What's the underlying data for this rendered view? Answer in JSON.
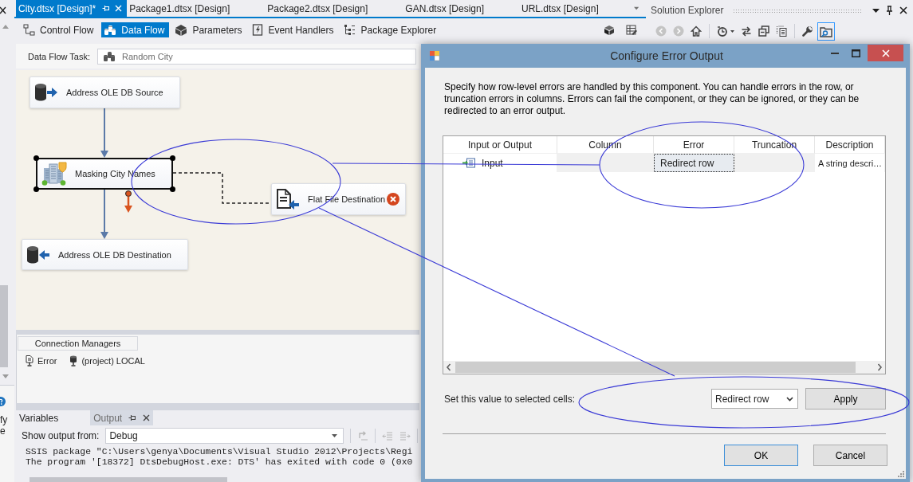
{
  "left_strip": {
    "fragments": [
      "fy",
      "e"
    ]
  },
  "document_tabs": [
    {
      "label": "City.dtsx [Design]*",
      "selected": true
    },
    {
      "label": "Package1.dtsx [Design]",
      "selected": false
    },
    {
      "label": "Package2.dtsx [Design]",
      "selected": false
    },
    {
      "label": "GAN.dtsx [Design]",
      "selected": false
    },
    {
      "label": "URL.dtsx [Design]",
      "selected": false
    }
  ],
  "designer_tabs": [
    {
      "kind": "control_flow",
      "label": "Control Flow",
      "selected": false
    },
    {
      "kind": "data_flow",
      "label": "Data Flow",
      "selected": true
    },
    {
      "kind": "parameters",
      "label": "Parameters",
      "selected": false
    },
    {
      "kind": "event_handlers",
      "label": "Event Handlers",
      "selected": false
    },
    {
      "kind": "package_explorer",
      "label": "Package Explorer",
      "selected": false
    }
  ],
  "data_flow_task": {
    "label": "Data Flow Task:",
    "value": "Random City"
  },
  "canvas": {
    "nodes": [
      {
        "kind": "ole_db_source",
        "label": "Address OLE DB Source",
        "selected": false,
        "error": false
      },
      {
        "kind": "masking",
        "label": "Masking City Names",
        "selected": true,
        "error": false
      },
      {
        "kind": "flat_file_destination",
        "label": "Flat File Destination",
        "selected": false,
        "error": true
      },
      {
        "kind": "ole_db_destination",
        "label": "Address OLE DB Destination",
        "selected": false,
        "error": false
      }
    ]
  },
  "connection_managers": {
    "title": "Connection Managers",
    "items": [
      {
        "kind": "file",
        "label": "Error"
      },
      {
        "kind": "database",
        "label": "(project) LOCAL"
      }
    ]
  },
  "output_window": {
    "tabs": [
      {
        "label": "Variables",
        "selected": false
      },
      {
        "label": "Output",
        "selected": true
      }
    ],
    "source_label": "Show output from:",
    "source": "Debug",
    "lines": [
      "SSIS package \"C:\\Users\\genya\\Documents\\Visual Studio 2012\\Projects\\Regi",
      "The program '[18372] DtsDebugHost.exe: DTS' has exited with code 0 (0x0"
    ]
  },
  "solution_explorer": {
    "title": "Solution Explorer",
    "toolbar": [
      {
        "kind": "back",
        "disabled": true,
        "selected": false
      },
      {
        "kind": "forward",
        "disabled": true,
        "selected": false
      },
      {
        "kind": "home",
        "disabled": false,
        "selected": false
      },
      {
        "kind": "history",
        "disabled": false,
        "selected": false
      },
      {
        "kind": "sync",
        "disabled": false,
        "selected": false
      },
      {
        "kind": "collapse",
        "disabled": false,
        "selected": false
      },
      {
        "kind": "pages",
        "disabled": false,
        "selected": false
      },
      {
        "kind": "properties",
        "disabled": false,
        "selected": false
      },
      {
        "kind": "preview",
        "disabled": false,
        "selected": true
      }
    ]
  },
  "dialog": {
    "title": "Configure Error Output",
    "description": "Specify how row-level errors are handled by this component. You can handle errors in the row, or truncation errors in columns. Errors can fail the component, or they can be ignored, or they can be redirected to an error output.",
    "table": {
      "columns": [
        "Input or Output",
        "Column",
        "Error",
        "Truncation",
        "Description"
      ],
      "rows": [
        {
          "cells": [
            {
              "text": "Input",
              "disabled": false,
              "selected": false
            },
            {
              "disabled": true,
              "selected": false
            },
            {
              "text": "Redirect row",
              "disabled": false,
              "selected": true
            },
            {
              "disabled": true,
              "selected": false
            },
            {
              "text": "A string descri…",
              "disabled": false,
              "selected": false
            }
          ]
        }
      ]
    },
    "set_value": {
      "label": "Set this value to selected cells:",
      "value": "Redirect row",
      "button": "Apply"
    },
    "buttons": [
      {
        "label": "OK",
        "default": true
      },
      {
        "label": "Cancel",
        "default": false
      }
    ]
  }
}
